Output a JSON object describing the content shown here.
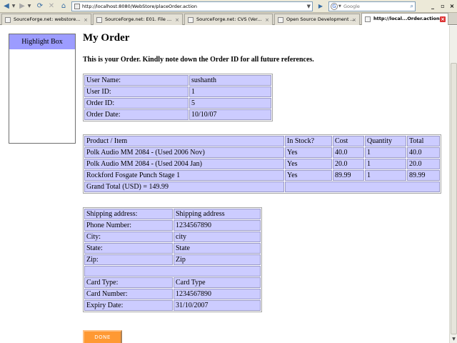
{
  "browser": {
    "nav_icons": [
      "back-icon",
      "forward-icon",
      "reload-icon",
      "stop-icon",
      "home-icon"
    ],
    "url": "http://localhost:8080/WebStore/placeOrder.action",
    "search_engine": "Google",
    "search_placeholder": "Google",
    "tabs": [
      {
        "label": "SourceForge.net: webstore...",
        "active": false
      },
      {
        "label": "SourceForge.net: E01. File ...",
        "active": false
      },
      {
        "label": "SourceForge.net: CVS (Ver...",
        "active": false
      },
      {
        "label": "Open Source Development ...",
        "active": false
      },
      {
        "label": "http://local...Order.action",
        "active": true
      }
    ]
  },
  "sidebar": {
    "title": "Highlight Box"
  },
  "page": {
    "title": "My Order",
    "intro": "This is your Order. Kindly note down the Order ID for all future references."
  },
  "user_info": {
    "rows": [
      {
        "label": "User Name:",
        "value": "sushanth"
      },
      {
        "label": "User ID:",
        "value": "1"
      },
      {
        "label": "Order ID:",
        "value": "5"
      },
      {
        "label": "Order Date:",
        "value": "10/10/07"
      }
    ]
  },
  "order": {
    "headers": [
      "Product / Item",
      "In Stock?",
      "Cost",
      "Quantity",
      "Total"
    ],
    "rows": [
      [
        "Polk Audio MM 2084 - (Used 2006 Nov)",
        "Yes",
        "40.0",
        "1",
        "40.0"
      ],
      [
        "Polk Audio MM 2084 - (Used 2004 Jan)",
        "Yes",
        "20.0",
        "1",
        "20.0"
      ],
      [
        "Rockford Fosgate Punch Stage 1",
        "Yes",
        "89.99",
        "1",
        "89.99"
      ]
    ],
    "grand_total": "Grand Total (USD) = 149.99"
  },
  "shipping": {
    "address_rows": [
      {
        "label": "Shipping address:",
        "value": "Shipping address"
      },
      {
        "label": "Phone Number:",
        "value": "1234567890"
      },
      {
        "label": "City:",
        "value": "city"
      },
      {
        "label": "State:",
        "value": "State"
      },
      {
        "label": "Zip:",
        "value": "Zip"
      }
    ],
    "card_rows": [
      {
        "label": "Card Type:",
        "value": "Card Type"
      },
      {
        "label": "Card Number:",
        "value": "1234567890"
      },
      {
        "label": "Expiry Date:",
        "value": "31/10/2007"
      }
    ]
  },
  "actions": {
    "done_label": "DONE"
  },
  "colors": {
    "table_cell": "#ccccff",
    "highlight_header": "#9c9cff",
    "done_button": "#ff9933"
  }
}
